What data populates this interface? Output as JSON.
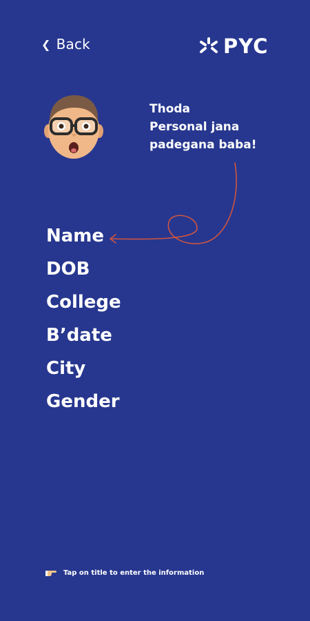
{
  "header": {
    "back_label": "Back",
    "back_icon": "chevron-left-icon",
    "logo_text": "PYC",
    "logo_icon": "pyc-logo-mark"
  },
  "speech": {
    "line1": "Thoda",
    "line2": "Personal jana",
    "line3": "padegana baba!"
  },
  "fields": [
    {
      "label": "Name"
    },
    {
      "label": "DOB"
    },
    {
      "label": "College"
    },
    {
      "label": "B’date"
    },
    {
      "label": "City"
    },
    {
      "label": "Gender"
    }
  ],
  "hint": {
    "text": "Tap on title to enter the information",
    "icon": "pointing-hand-icon"
  },
  "colors": {
    "background": "#27378f",
    "text": "#ffffff",
    "arrow": "#d0553f"
  }
}
